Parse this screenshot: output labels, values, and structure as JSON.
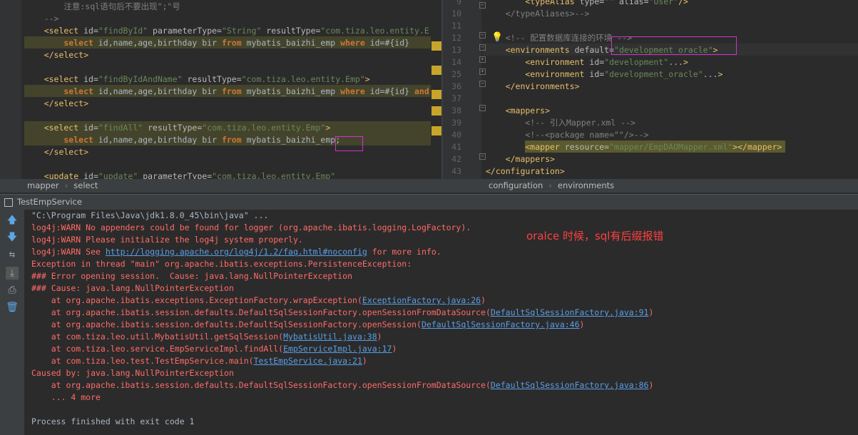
{
  "left_editor": {
    "lines": [
      {
        "parts": [
          [
            "c",
            "        注意:sql语句后不要出现\";\"号"
          ]
        ]
      },
      {
        "parts": [
          [
            "c",
            "    -->"
          ]
        ]
      },
      {
        "parts": [
          [
            "t",
            "    <select "
          ],
          [
            "a",
            "id="
          ],
          [
            "v",
            "\"findById\" "
          ],
          [
            "a",
            "parameterType="
          ],
          [
            "v",
            "\"String\" "
          ],
          [
            "a",
            "resultType="
          ],
          [
            "v",
            "\"com.tiza.leo.entity.E"
          ]
        ]
      },
      {
        "parts": [
          [
            "k",
            "        select "
          ],
          [
            "p",
            "id,name,age,birthday bir "
          ],
          [
            "k",
            "from "
          ],
          [
            "p",
            "mybatis_baizhi_emp "
          ],
          [
            "k",
            "where "
          ],
          [
            "p",
            "id=#{id}"
          ]
        ]
      },
      {
        "parts": [
          [
            "t",
            "    </select>"
          ]
        ]
      },
      {
        "parts": [
          [
            "p",
            ""
          ]
        ]
      },
      {
        "parts": [
          [
            "t",
            "    <select "
          ],
          [
            "a",
            "id="
          ],
          [
            "v",
            "\"findByIdAndName\" "
          ],
          [
            "a",
            "resultType="
          ],
          [
            "v",
            "\"com.tiza.leo.entity.Emp\""
          ],
          [
            "t",
            ">"
          ]
        ]
      },
      {
        "parts": [
          [
            "k",
            "        select "
          ],
          [
            "p",
            "id,name,age,birthday bir "
          ],
          [
            "k",
            "from "
          ],
          [
            "p",
            "mybatis_baizhi_emp "
          ],
          [
            "k",
            "where "
          ],
          [
            "p",
            "id=#{id} "
          ],
          [
            "k",
            "and"
          ]
        ]
      },
      {
        "parts": [
          [
            "t",
            "    </select>"
          ]
        ]
      },
      {
        "parts": [
          [
            "p",
            ""
          ]
        ]
      },
      {
        "parts": [
          [
            "t",
            "    <select "
          ],
          [
            "a",
            "id="
          ],
          [
            "v",
            "\"findAll\" "
          ],
          [
            "a",
            "resultType="
          ],
          [
            "v",
            "\"com.tiza.leo.entity.Emp\""
          ],
          [
            "t",
            ">"
          ]
        ]
      },
      {
        "parts": [
          [
            "k",
            "        select "
          ],
          [
            "p",
            "id,name,age,birthday bir "
          ],
          [
            "k",
            "from "
          ],
          [
            "p",
            "mybatis_baizhi_emp;"
          ]
        ]
      },
      {
        "parts": [
          [
            "t",
            "    </select>"
          ]
        ]
      },
      {
        "parts": [
          [
            "p",
            ""
          ]
        ]
      },
      {
        "parts": [
          [
            "t",
            "    <update "
          ],
          [
            "a",
            "id="
          ],
          [
            "v",
            "\"update\" "
          ],
          [
            "a",
            "parameterType="
          ],
          [
            "v",
            "\"com.tiza.leo.entity.Emp\""
          ]
        ]
      }
    ]
  },
  "right_editor": {
    "lines": [
      {
        "num": "9",
        "parts": [
          [
            "t",
            "        <typeAlias "
          ],
          [
            "a",
            "type="
          ],
          [
            "v",
            "\"\" "
          ],
          [
            "a",
            "alias="
          ],
          [
            "v",
            "\"User\""
          ],
          [
            "t",
            "/>"
          ]
        ]
      },
      {
        "num": "10",
        "parts": [
          [
            "c",
            "    </typeAliases>-->"
          ]
        ]
      },
      {
        "num": "11",
        "parts": [
          [
            "p",
            ""
          ]
        ]
      },
      {
        "num": "12",
        "parts": [
          [
            "c",
            "    <!-- 配置数据库连接的环境 -->"
          ]
        ]
      },
      {
        "num": "13",
        "parts": [
          [
            "t",
            "    <environments "
          ],
          [
            "a",
            "default="
          ],
          [
            "v",
            "\"development_oracle\""
          ],
          [
            "t",
            ">"
          ]
        ]
      },
      {
        "num": "14",
        "parts": [
          [
            "t",
            "        <environment "
          ],
          [
            "a",
            "id="
          ],
          [
            "v",
            "\"development\""
          ],
          [
            "p",
            "..."
          ],
          [
            "t",
            ">"
          ]
        ]
      },
      {
        "num": "25",
        "parts": [
          [
            "t",
            "        <environment "
          ],
          [
            "a",
            "id="
          ],
          [
            "v",
            "\"development_oracle\""
          ],
          [
            "p",
            "..."
          ],
          [
            "t",
            ">"
          ]
        ]
      },
      {
        "num": "36",
        "parts": [
          [
            "t",
            "    </environments>"
          ]
        ]
      },
      {
        "num": "37",
        "parts": [
          [
            "p",
            ""
          ]
        ]
      },
      {
        "num": "38",
        "parts": [
          [
            "t",
            "    <mappers>"
          ]
        ]
      },
      {
        "num": "39",
        "parts": [
          [
            "c",
            "        <!-- 引入Mapper.xml -->"
          ]
        ]
      },
      {
        "num": "40",
        "parts": [
          [
            "c",
            "        <!--<package name=\"\"/>-->"
          ]
        ]
      },
      {
        "num": "41",
        "parts": [
          [
            "t",
            "        <mapper "
          ],
          [
            "a",
            "resource="
          ],
          [
            "v",
            "\"mapper/EmpDAOMapper.xml\""
          ],
          [
            "t",
            "></mapper>"
          ]
        ]
      },
      {
        "num": "42",
        "parts": [
          [
            "t",
            "    </mappers>"
          ]
        ]
      },
      {
        "num": "43",
        "parts": [
          [
            "t",
            "</configuration>"
          ]
        ]
      }
    ]
  },
  "left_crumbs": [
    "mapper",
    "select"
  ],
  "right_crumbs": [
    "configuration",
    "environments"
  ],
  "run_tab": "TestEmpService",
  "annotation": "oralce 时候，sql有后缀报错",
  "console": [
    {
      "cls": "gray",
      "parts": [
        [
          "gray",
          "\"C:\\Program Files\\Java\\jdk1.8.0_45\\bin\\java\" ..."
        ]
      ]
    },
    {
      "cls": "red",
      "parts": [
        [
          "red",
          "log4j:WARN No appenders could be found for logger (org.apache.ibatis.logging.LogFactory)."
        ]
      ]
    },
    {
      "cls": "red",
      "parts": [
        [
          "red",
          "log4j:WARN Please initialize the log4j system properly."
        ]
      ]
    },
    {
      "cls": "red",
      "parts": [
        [
          "red",
          "log4j:WARN See "
        ],
        [
          "lnk",
          "http://logging.apache.org/log4j/1.2/faq.html#noconfig"
        ],
        [
          "red",
          " for more info."
        ]
      ]
    },
    {
      "cls": "red",
      "parts": [
        [
          "red",
          "Exception in thread \"main\" org.apache.ibatis.exceptions.PersistenceException:"
        ]
      ]
    },
    {
      "cls": "red",
      "parts": [
        [
          "red",
          "### Error opening session.  Cause: java.lang.NullPointerException"
        ]
      ]
    },
    {
      "cls": "red",
      "parts": [
        [
          "red",
          "### Cause: java.lang.NullPointerException"
        ]
      ]
    },
    {
      "cls": "red",
      "parts": [
        [
          "red",
          "    at org.apache.ibatis.exceptions.ExceptionFactory.wrapException("
        ],
        [
          "lnk",
          "ExceptionFactory.java:26"
        ],
        [
          "red",
          ")"
        ]
      ]
    },
    {
      "cls": "red",
      "parts": [
        [
          "red",
          "    at org.apache.ibatis.session.defaults.DefaultSqlSessionFactory.openSessionFromDataSource("
        ],
        [
          "lnk",
          "DefaultSqlSessionFactory.java:91"
        ],
        [
          "red",
          ")"
        ]
      ]
    },
    {
      "cls": "red",
      "parts": [
        [
          "red",
          "    at org.apache.ibatis.session.defaults.DefaultSqlSessionFactory.openSession("
        ],
        [
          "lnk",
          "DefaultSqlSessionFactory.java:46"
        ],
        [
          "red",
          ")"
        ]
      ]
    },
    {
      "cls": "red",
      "parts": [
        [
          "red",
          "    at com.tiza.leo.util.MybatisUtil.getSqlSession("
        ],
        [
          "lnk",
          "MybatisUtil.java:38"
        ],
        [
          "red",
          ")"
        ]
      ]
    },
    {
      "cls": "red",
      "parts": [
        [
          "red",
          "    at com.tiza.leo.service.EmpServiceImpl.findAll("
        ],
        [
          "lnk",
          "EmpServiceImpl.java:17"
        ],
        [
          "red",
          ")"
        ]
      ]
    },
    {
      "cls": "red",
      "parts": [
        [
          "red",
          "    at com.tiza.leo.test.TestEmpService.main("
        ],
        [
          "lnk",
          "TestEmpService.java:21"
        ],
        [
          "red",
          ")"
        ]
      ]
    },
    {
      "cls": "red",
      "parts": [
        [
          "red",
          "Caused by: java.lang.NullPointerException"
        ]
      ]
    },
    {
      "cls": "red",
      "parts": [
        [
          "red",
          "    at org.apache.ibatis.session.defaults.DefaultSqlSessionFactory.openSessionFromDataSource("
        ],
        [
          "lnk",
          "DefaultSqlSessionFactory.java:86"
        ],
        [
          "red",
          ")"
        ]
      ]
    },
    {
      "cls": "red",
      "parts": [
        [
          "red",
          "    ... 4 more"
        ]
      ]
    },
    {
      "cls": "gray",
      "parts": [
        [
          "gray",
          ""
        ]
      ]
    },
    {
      "cls": "gray",
      "parts": [
        [
          "gray",
          "Process finished with exit code 1"
        ]
      ]
    }
  ],
  "toolbar_icons": [
    "arrow-up-icon",
    "arrow-down-icon",
    "soft-wrap-icon",
    "scroll-to-end-icon",
    "print-icon",
    "trash-icon"
  ],
  "colors": {
    "background": "#2b2b2b",
    "error": "#ff6b68",
    "link": "#5a9ee6",
    "annotation": "#ff4040",
    "highlight_box": "#cc33cc"
  }
}
